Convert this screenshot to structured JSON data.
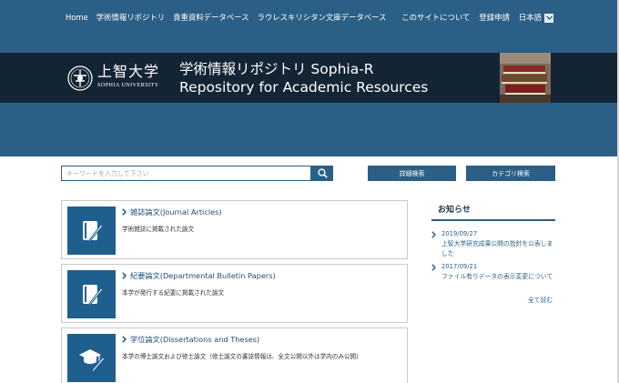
{
  "nav": {
    "left": [
      "Home",
      "学術情報リポジトリ",
      "貴重資料データベース",
      "ラウレスキリシタン文庫データベース"
    ],
    "right": [
      "このサイトについて",
      "登録申請"
    ],
    "language": "日本語"
  },
  "banner": {
    "university_jp": "上智大学",
    "university_en": "SOPHIA UNIVERSITY",
    "title_line1": "学術情報リポジトリ Sophia-R",
    "title_line2": "Repository for Academic Resources"
  },
  "search": {
    "placeholder": "キーワードを入力して下さい",
    "advanced_label": "詳細検索",
    "category_label": "カテゴリ検索"
  },
  "categories": [
    {
      "title": "雑誌論文(Journal Articles)",
      "description": "学術雑誌に掲載された論文",
      "icon": "notebook-pen-icon"
    },
    {
      "title": "紀要論文(Departmental Bulletin Papers)",
      "description": "本学が発行する紀要に掲載された論文",
      "icon": "notebook-pen-icon"
    },
    {
      "title": "学位論文(Dissertations and Theses)",
      "description": "本学の博士論文および修士論文（修士論文の書誌情報は、全文公開以外は学内のみ公開)",
      "icon": "graduation-cap-pen-icon"
    }
  ],
  "news": {
    "heading": "お知らせ",
    "items": [
      {
        "date": "2019/09/27",
        "text": "上智大学研究成果公開の指針を公表しました"
      },
      {
        "date": "2017/09/21",
        "text": "ファイル有りデータの表示変更について"
      }
    ],
    "read_all": "全て読む"
  },
  "colors": {
    "primary": "#2b5f86",
    "banner_dark": "#132535",
    "icon_bg": "#1f5f8e",
    "link": "#2b5f86"
  }
}
